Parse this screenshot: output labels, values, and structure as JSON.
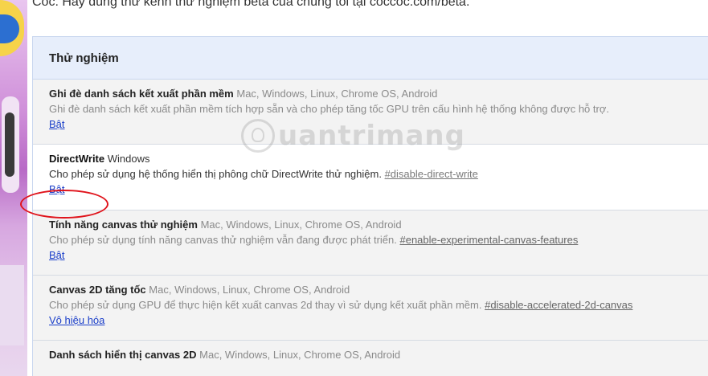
{
  "intro_text": "Cốc. Hãy dùng thử kênh thử nghiệm beta của chúng tôi tại coccoc.com/beta.",
  "section_title": "Thử nghiệm",
  "watermark_text": "uantrimang",
  "experiments": [
    {
      "name": "Ghi đè danh sách kết xuất phần mềm",
      "platforms": "Mac, Windows, Linux, Chrome OS, Android",
      "description": "Ghi đè danh sách kết xuất phần mềm tích hợp sẵn và cho phép tăng tốc GPU trên cấu hình hệ thống không được hỗ trợ.",
      "flag": "",
      "action": "Bật",
      "state": "disabled"
    },
    {
      "name": "DirectWrite",
      "platforms": "Windows",
      "description": "Cho phép sử dụng hệ thống hiển thị phông chữ DirectWrite thử nghiệm.",
      "flag": "#disable-direct-write",
      "action": "Bật",
      "state": "enabled"
    },
    {
      "name": "Tính năng canvas thử nghiệm",
      "platforms": "Mac, Windows, Linux, Chrome OS, Android",
      "description": "Cho phép sử dụng tính năng canvas thử nghiệm vẫn đang được phát triển.",
      "flag": "#enable-experimental-canvas-features",
      "action": "Bật",
      "state": "disabled"
    },
    {
      "name": "Canvas 2D tăng tốc",
      "platforms": "Mac, Windows, Linux, Chrome OS, Android",
      "description": "Cho phép sử dụng GPU để thực hiện kết xuất canvas 2d thay vì sử dụng kết xuất phần mềm.",
      "flag": "#disable-accelerated-2d-canvas",
      "action": "Vô hiệu hóa",
      "state": "disabled"
    },
    {
      "name": "Danh sách hiển thị canvas 2D",
      "platforms": "Mac, Windows, Linux, Chrome OS, Android",
      "description": "",
      "flag": "",
      "action": "",
      "state": "disabled"
    }
  ],
  "colors": {
    "link": "#1a3ec9",
    "highlight": "#e0141c",
    "header_bg": "#e7eefb"
  }
}
